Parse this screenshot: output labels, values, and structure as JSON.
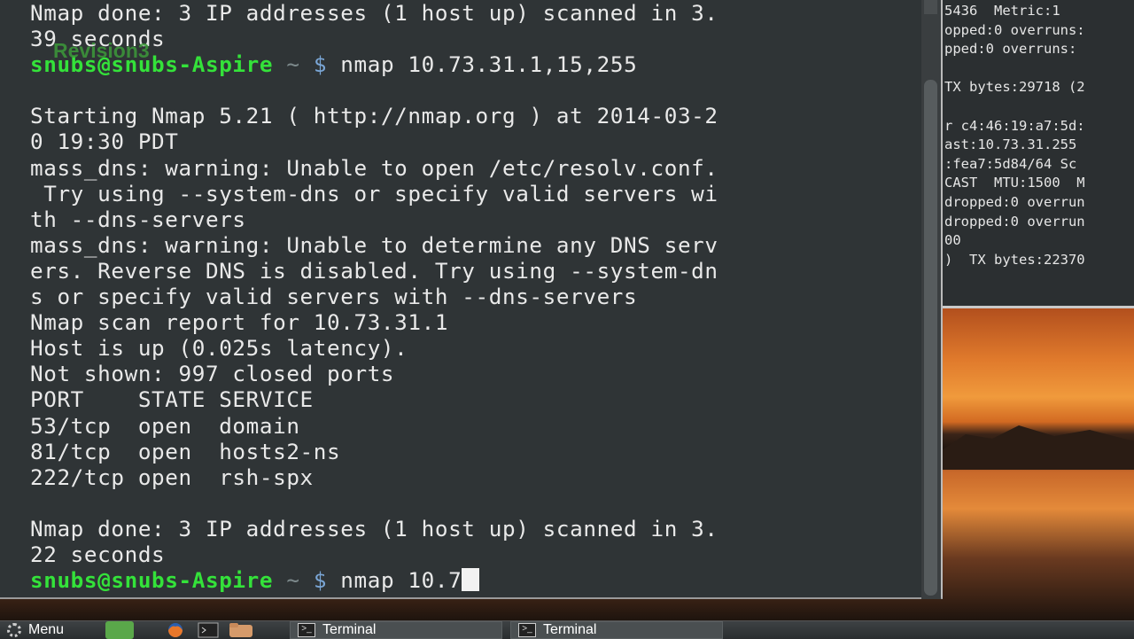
{
  "watermark": "Revision3",
  "main_terminal": {
    "lines": [
      {
        "type": "text",
        "text": "Nmap done: 3 IP addresses (1 host up) scanned in 3."
      },
      {
        "type": "text",
        "text": "39 seconds"
      },
      {
        "type": "prompt",
        "user": "snubs@snubs-Aspire",
        "path": "~",
        "dollar": "$",
        "command": "nmap 10.73.31.1,15,255"
      },
      {
        "type": "text",
        "text": ""
      },
      {
        "type": "text",
        "text": "Starting Nmap 5.21 ( http://nmap.org ) at 2014-03-2"
      },
      {
        "type": "text",
        "text": "0 19:30 PDT"
      },
      {
        "type": "text",
        "text": "mass_dns: warning: Unable to open /etc/resolv.conf."
      },
      {
        "type": "text",
        "text": " Try using --system-dns or specify valid servers wi"
      },
      {
        "type": "text",
        "text": "th --dns-servers"
      },
      {
        "type": "text",
        "text": "mass_dns: warning: Unable to determine any DNS serv"
      },
      {
        "type": "text",
        "text": "ers. Reverse DNS is disabled. Try using --system-dn"
      },
      {
        "type": "text",
        "text": "s or specify valid servers with --dns-servers"
      },
      {
        "type": "text",
        "text": "Nmap scan report for 10.73.31.1"
      },
      {
        "type": "text",
        "text": "Host is up (0.025s latency)."
      },
      {
        "type": "text",
        "text": "Not shown: 997 closed ports"
      },
      {
        "type": "text",
        "text": "PORT    STATE SERVICE"
      },
      {
        "type": "text",
        "text": "53/tcp  open  domain"
      },
      {
        "type": "text",
        "text": "81/tcp  open  hosts2-ns"
      },
      {
        "type": "text",
        "text": "222/tcp open  rsh-spx"
      },
      {
        "type": "text",
        "text": ""
      },
      {
        "type": "text",
        "text": "Nmap done: 3 IP addresses (1 host up) scanned in 3."
      },
      {
        "type": "text",
        "text": "22 seconds"
      },
      {
        "type": "prompt",
        "user": "snubs@snubs-Aspire",
        "path": "~",
        "dollar": "$",
        "command": "nmap 10.7",
        "cursor": true
      }
    ]
  },
  "bg_terminal": {
    "lines": [
      "5436  Metric:1",
      "opped:0 overruns:",
      "pped:0 overruns:",
      "",
      "TX bytes:29718 (2",
      "",
      "r c4:46:19:a7:5d:",
      "ast:10.73.31.255",
      ":fea7:5d84/64 Sc",
      "CAST  MTU:1500  M",
      "dropped:0 overrun",
      "dropped:0 overrun",
      "00",
      ")  TX bytes:22370"
    ]
  },
  "taskbar": {
    "menu_label": "Menu",
    "tasks": [
      {
        "label": "Terminal"
      },
      {
        "label": "Terminal"
      }
    ]
  }
}
